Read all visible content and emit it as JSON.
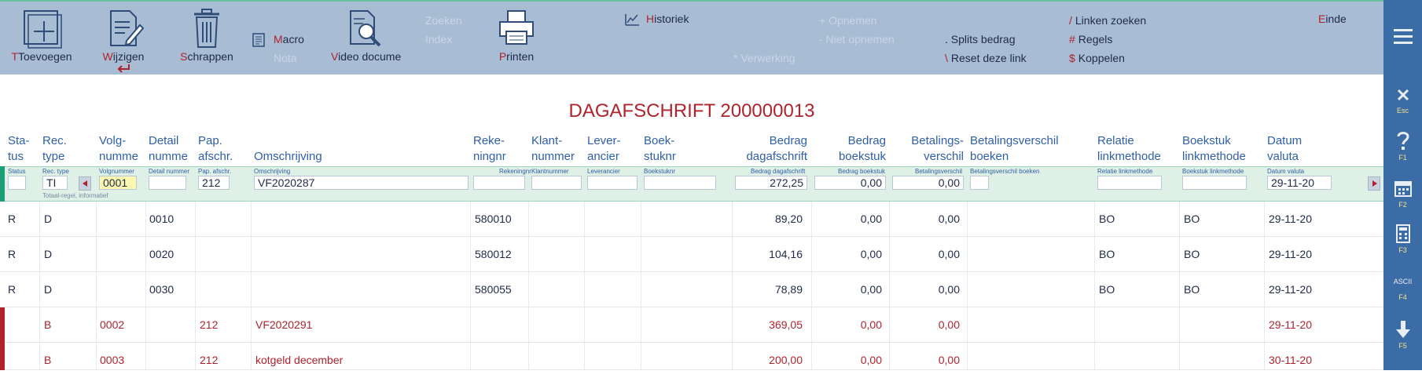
{
  "toolbar": {
    "add_label": "Toevoegen",
    "add_hotkey": "T",
    "edit_label": "ijzigen",
    "edit_hotkey": "W",
    "delete_label": "chrappen",
    "delete_hotkey": "S",
    "macro_label": "acro",
    "macro_hotkey": "M",
    "nota_label": "Nota",
    "video_label": "ideo docume",
    "video_hotkey": "V",
    "search_label": "Zoeken",
    "index_label": "Index",
    "print_label": "rinten",
    "print_hotkey": "P",
    "history_label": "istoriek",
    "history_hotkey": "H",
    "processing_label": "* Verwerking",
    "include_label": "+ Opnemen",
    "exclude_label": "- Niet opnemen",
    "split_label": ". Splits bedrag",
    "reset_link_label": "Reset deze link",
    "reset_link_symbol": "\\",
    "link_search_label": "Linken zoeken",
    "link_search_symbol": "/",
    "rules_label": "Regels",
    "rules_symbol": "#",
    "couple_label": "Koppelen",
    "couple_symbol": "$",
    "end_label": "inde",
    "end_hotkey": "E"
  },
  "rail": {
    "esc_label": "Esc",
    "help_label": "F1",
    "calendar_label": "F2",
    "calculator_label": "F3",
    "ascii_text": "ASCII",
    "ascii_label": "F4",
    "down_label": "F5"
  },
  "page_title": "DAGAFSCHRIFT 200000013",
  "headers": {
    "status": [
      "Sta-",
      "tus"
    ],
    "rec_type": [
      "Rec.",
      "type"
    ],
    "volgnummer": [
      "Volg-",
      "numme"
    ],
    "detail": [
      "Detail",
      "numme"
    ],
    "pap": [
      "Pap.",
      "afschr."
    ],
    "omschrijving": [
      "",
      "Omschrijving"
    ],
    "rekening": [
      "Reke-",
      "ningnr"
    ],
    "klant": [
      "Klant-",
      "nummer"
    ],
    "leverancier": [
      "Lever-",
      "ancier"
    ],
    "boekstuk": [
      "Boek-",
      "stuknr"
    ],
    "bedrag_dag": [
      "Bedrag",
      "dagafschrift"
    ],
    "bedrag_boek": [
      "Bedrag",
      "boekstuk"
    ],
    "betalingsverschil": [
      "Betalings-",
      "verschil"
    ],
    "betverschil_boeken": [
      "Betalingsverschil",
      "boeken"
    ],
    "relatie": [
      "Relatie",
      "linkmethode"
    ],
    "boekstuk_link": [
      "Boekstuk",
      "linkmethode"
    ],
    "datum": [
      "Datum",
      "valuta"
    ]
  },
  "filter": {
    "labels": {
      "status": "Status",
      "rec_type": "Rec. type",
      "volgnummer": "Volgnummer",
      "detail": "Detail nummer",
      "pap": "Pap. afschr.",
      "omschrijving": "Omschrijving",
      "rekening": "Rekeningnr",
      "klant": "Klantnummer",
      "leverancier": "Leverancier",
      "boekstuk": "Boekstuknr",
      "bedrag_dag": "Bedrag dagafschrift",
      "bedrag_boek": "Bedrag boekstuk",
      "betalingsverschil": "Betalingsverschil",
      "betverschil_boeken": "Betalingsverschil boeken",
      "relatie": "Relatie linkmethode",
      "boekstuk_link": "Boekstuk linkmethode",
      "datum": "Datum valuta"
    },
    "values": {
      "status": "",
      "rec_type": "TI",
      "volgnummer": "0001",
      "detail": "",
      "pap": "212",
      "omschrijving": "VF2020287",
      "rekening": "",
      "klant": "",
      "leverancier": "",
      "boekstuk": "",
      "bedrag_dag": "272,25",
      "bedrag_boek": "0,00",
      "betalingsverschil": "0,00",
      "betverschil_boeken": "",
      "relatie": "",
      "boekstuk_link": "",
      "datum": "29-11-20"
    },
    "hint": "Totaal-regel, informatief"
  },
  "rows": [
    {
      "status": "R",
      "rec_type": "D",
      "volg": "",
      "detail": "0010",
      "pap": "",
      "omschrijving": "",
      "rekening": "580010",
      "bedrag_dag": "89,20",
      "bedrag_boek": "0,00",
      "betverschil": "0,00",
      "relatie": "BO",
      "boekstuk_link": "BO",
      "datum": "29-11-20"
    },
    {
      "status": "R",
      "rec_type": "D",
      "volg": "",
      "detail": "0020",
      "pap": "",
      "omschrijving": "",
      "rekening": "580012",
      "bedrag_dag": "104,16",
      "bedrag_boek": "0,00",
      "betverschil": "0,00",
      "relatie": "BO",
      "boekstuk_link": "BO",
      "datum": "29-11-20"
    },
    {
      "status": "R",
      "rec_type": "D",
      "volg": "",
      "detail": "0030",
      "pap": "",
      "omschrijving": "",
      "rekening": "580055",
      "bedrag_dag": "78,89",
      "bedrag_boek": "0,00",
      "betverschil": "0,00",
      "relatie": "BO",
      "boekstuk_link": "BO",
      "datum": "29-11-20"
    },
    {
      "status": "",
      "rec_type": "B",
      "volg": "0002",
      "detail": "",
      "pap": "212",
      "omschrijving": "VF2020291",
      "rekening": "",
      "bedrag_dag": "369,05",
      "bedrag_boek": "0,00",
      "betverschil": "0,00",
      "relatie": "",
      "boekstuk_link": "",
      "datum": "29-11-20"
    },
    {
      "status": "",
      "rec_type": "B",
      "volg": "0003",
      "detail": "",
      "pap": "212",
      "omschrijving": "kotgeld december",
      "rekening": "",
      "bedrag_dag": "200,00",
      "bedrag_boek": "0,00",
      "betverschil": "0,00",
      "relatie": "",
      "boekstuk_link": "",
      "datum": "30-11-20"
    }
  ],
  "colors": {
    "accent_red": "#b0232d",
    "header_blue": "#2f5fa8",
    "toolbar_bg": "#a8bcd4",
    "rail_bg": "#3c6ca6",
    "filter_bg": "#dff0e6"
  }
}
